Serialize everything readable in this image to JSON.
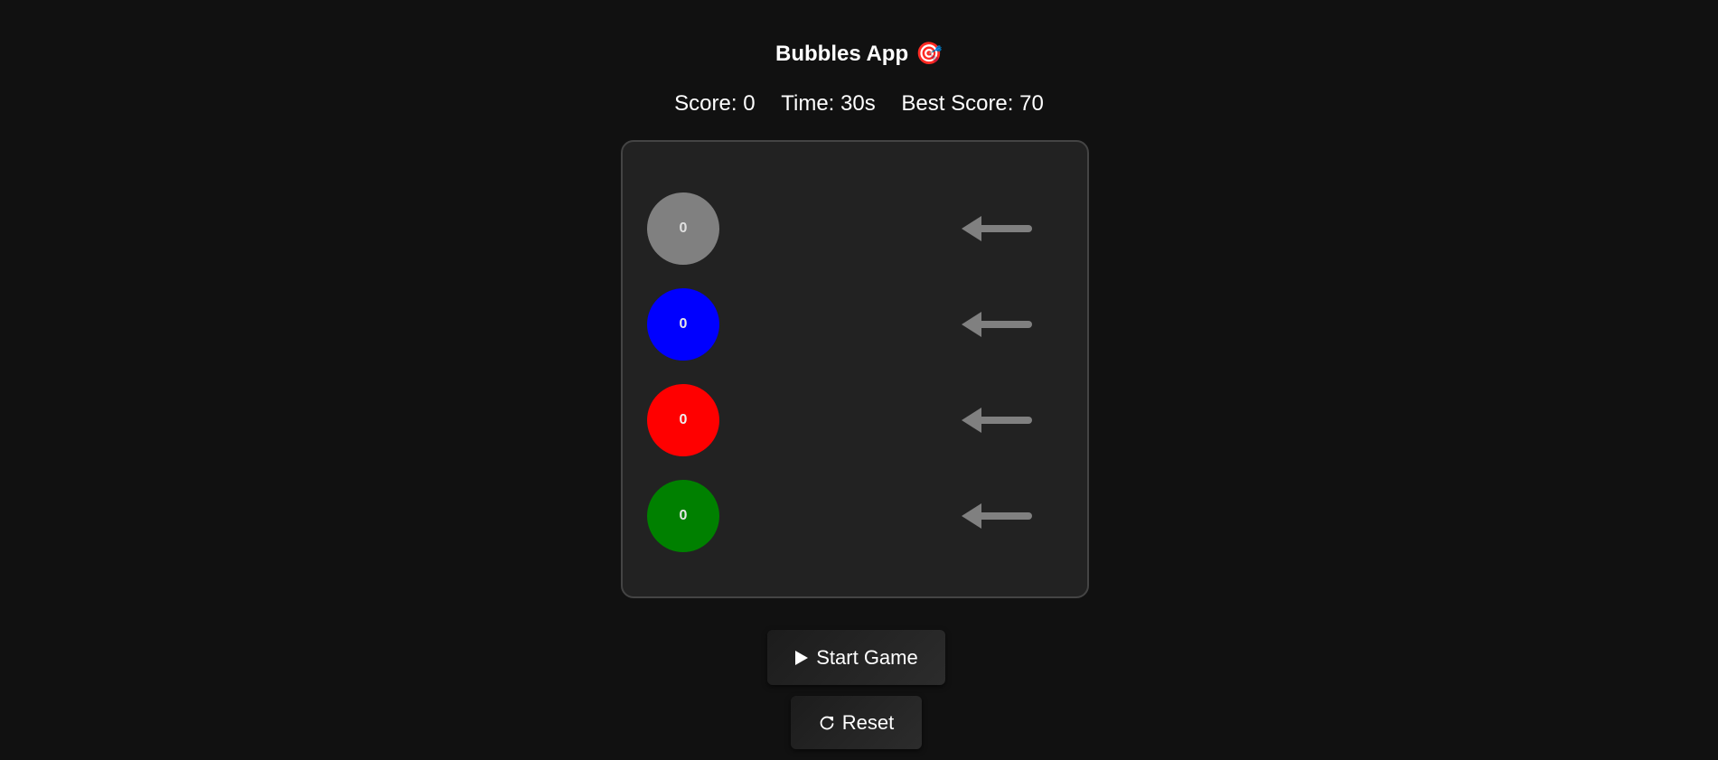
{
  "title": "Bubbles App",
  "title_emoji": "🎯",
  "stats": {
    "score": "Score: 0",
    "time": "Time: 30s",
    "best": "Best Score: 70"
  },
  "bubbles": [
    {
      "color": "#808080",
      "count": "0",
      "label_color": "#e0e0e0"
    },
    {
      "color": "#0000ff",
      "count": "0",
      "label_color": "#e8e8e8"
    },
    {
      "color": "#ff0000",
      "count": "0",
      "label_color": "#f0f0f0"
    },
    {
      "color": "#008000",
      "count": "0",
      "label_color": "#e8e8e8"
    }
  ],
  "arrow_color": "#808080",
  "buttons": {
    "start_icon": "play-icon",
    "start_label": "Start Game",
    "reset_icon": "reset-icon",
    "reset_label": "Reset"
  }
}
